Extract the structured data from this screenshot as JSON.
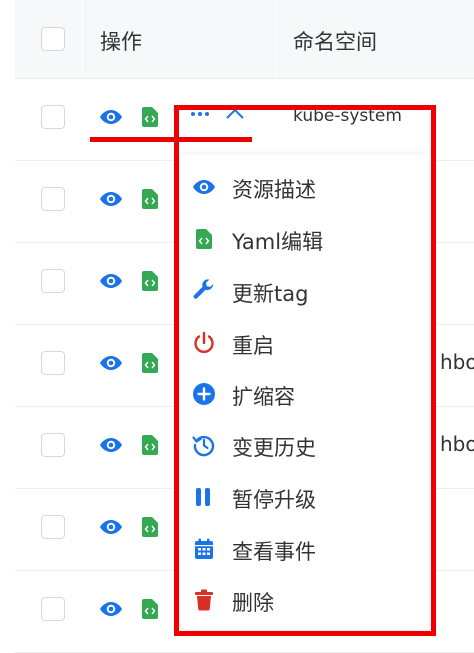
{
  "header": {
    "col_action": "操作",
    "col_namespace": "命名空间"
  },
  "rows": [
    {
      "namespace": "kube-system"
    },
    {
      "namespace": ""
    },
    {
      "namespace": ""
    },
    {
      "namespace": "hboa"
    },
    {
      "namespace": "hboa"
    },
    {
      "namespace": ""
    },
    {
      "namespace": ""
    }
  ],
  "menu": {
    "items": [
      {
        "label": "资源描述",
        "icon": "eye-icon",
        "color": "#1a73e8"
      },
      {
        "label": "Yaml编辑",
        "icon": "code-file-icon",
        "color": "#34a853"
      },
      {
        "label": "更新tag",
        "icon": "wrench-icon",
        "color": "#1a73e8"
      },
      {
        "label": "重启",
        "icon": "power-icon",
        "color": "#d93025"
      },
      {
        "label": "扩缩容",
        "icon": "plus-circle-icon",
        "color": "#1a73e8"
      },
      {
        "label": "变更历史",
        "icon": "history-icon",
        "color": "#1a73e8"
      },
      {
        "label": "暂停升级",
        "icon": "pause-icon",
        "color": "#1a73e8"
      },
      {
        "label": "查看事件",
        "icon": "calendar-icon",
        "color": "#1a73e8"
      },
      {
        "label": "删除",
        "icon": "trash-icon",
        "color": "#d93025"
      }
    ]
  },
  "colors": {
    "accent": "#1a73e8",
    "green": "#34a853",
    "red": "#d93025",
    "annotation_red": "#ee0000"
  }
}
